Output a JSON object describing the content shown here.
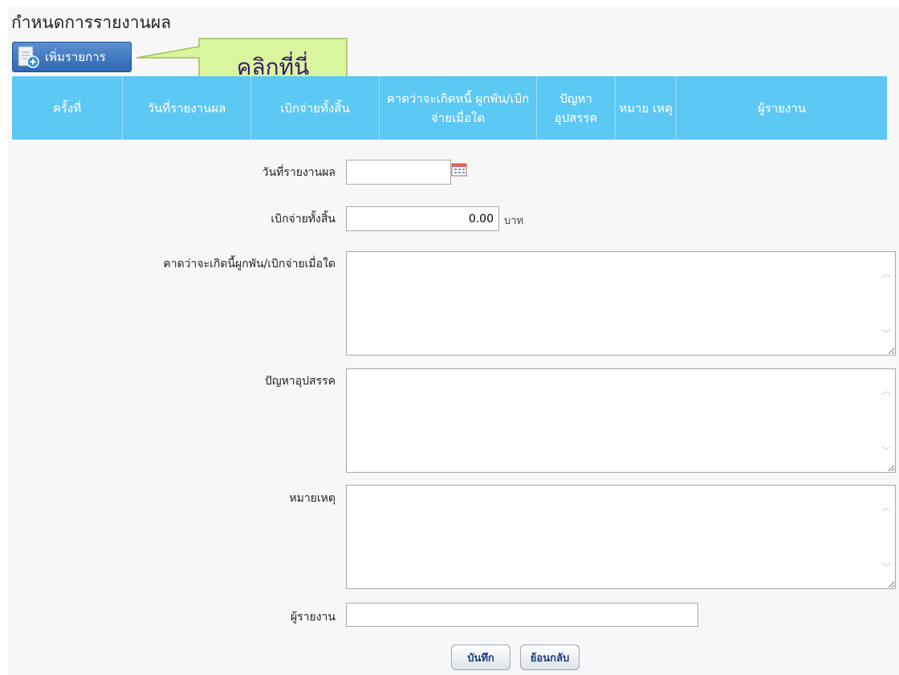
{
  "page": {
    "title": "กำหนดการรายงานผล"
  },
  "toolbar": {
    "add_label": "เพิ่มรายการ"
  },
  "callout": {
    "text": "คลิกที่นี่"
  },
  "table": {
    "columns": [
      "ครั้งที่",
      "วันที่รายงานผล",
      "เบิกจ่ายทั้งสิ้น",
      "คาดว่าจะเกิดหนี้ ผูกพัน/เบิกจ่ายเมื่อใด",
      "ปัญหา อุปสรรค",
      "หมาย เหตุ",
      "ผู้รายงาน"
    ]
  },
  "form": {
    "report_date": {
      "label": "วันที่รายงานผล",
      "value": ""
    },
    "total_disbursed": {
      "label": "เบิกจ่ายทั้งสิ้น",
      "value": "0.00",
      "unit": "บาท"
    },
    "expected_commitment": {
      "label": "คาดว่าจะเกิดนี้ผูกพัน/เบิกจ่ายเมื่อใด",
      "value": ""
    },
    "problems": {
      "label": "ปัญหาอุปสรรค",
      "value": ""
    },
    "remarks": {
      "label": "หมายเหตุ",
      "value": ""
    },
    "reporter": {
      "label": "ผู้รายงาน",
      "value": ""
    }
  },
  "actions": {
    "save_label": "บันทึก",
    "back_label": "ย้อนกลับ"
  },
  "colors": {
    "header": "#5cc8f4",
    "button": "#2f67b2",
    "callout": "#d9f59e"
  }
}
